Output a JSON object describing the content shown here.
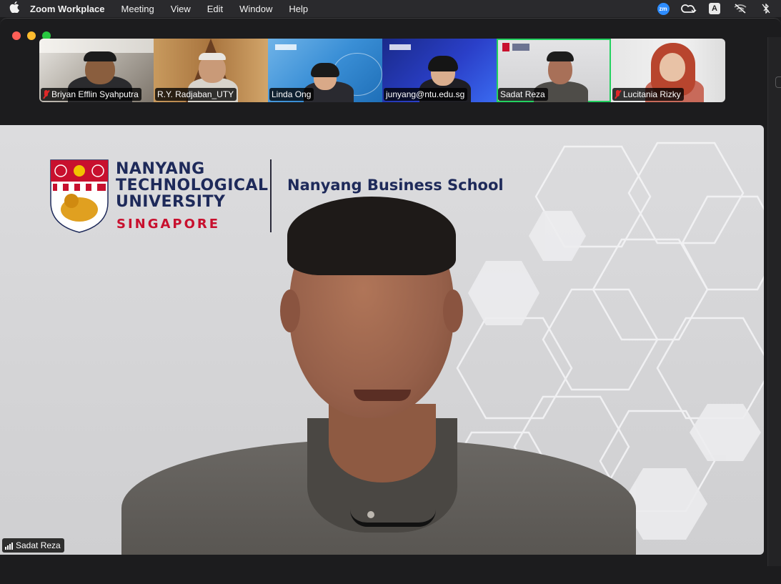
{
  "menubar": {
    "app_name": "Zoom Workplace",
    "items": [
      "Meeting",
      "View",
      "Edit",
      "Window",
      "Help"
    ],
    "status_icons": [
      "zoom-status-icon",
      "creative-cloud-icon",
      "input-source-icon",
      "wifi-off-icon",
      "bluetooth-off-icon"
    ],
    "zoom_badge": "zm",
    "input_source": "A"
  },
  "participants": [
    {
      "name": "Briyan Efflin Syahputra",
      "muted": true
    },
    {
      "name": "R.Y. Radjaban_UTY",
      "muted": false
    },
    {
      "name": "Linda Ong",
      "muted": false
    },
    {
      "name": "junyang@ntu.edu.sg",
      "muted": false
    },
    {
      "name": "Sadat Reza",
      "muted": false,
      "active_speaker": true
    },
    {
      "name": "Lucitania Rizky",
      "muted": true
    }
  ],
  "main_video": {
    "speaker_name": "Sadat Reza",
    "background": {
      "university_line1": "NANYANG",
      "university_line2": "TECHNOLOGICAL",
      "university_line3": "UNIVERSITY",
      "university_country": "SINGAPORE",
      "school_name": "Nanyang Business School"
    }
  },
  "colors": {
    "active_border": "#23d160",
    "muted_mic": "#e02828",
    "ntu_blue": "#1e2a5a",
    "ntu_red": "#c8102e"
  }
}
